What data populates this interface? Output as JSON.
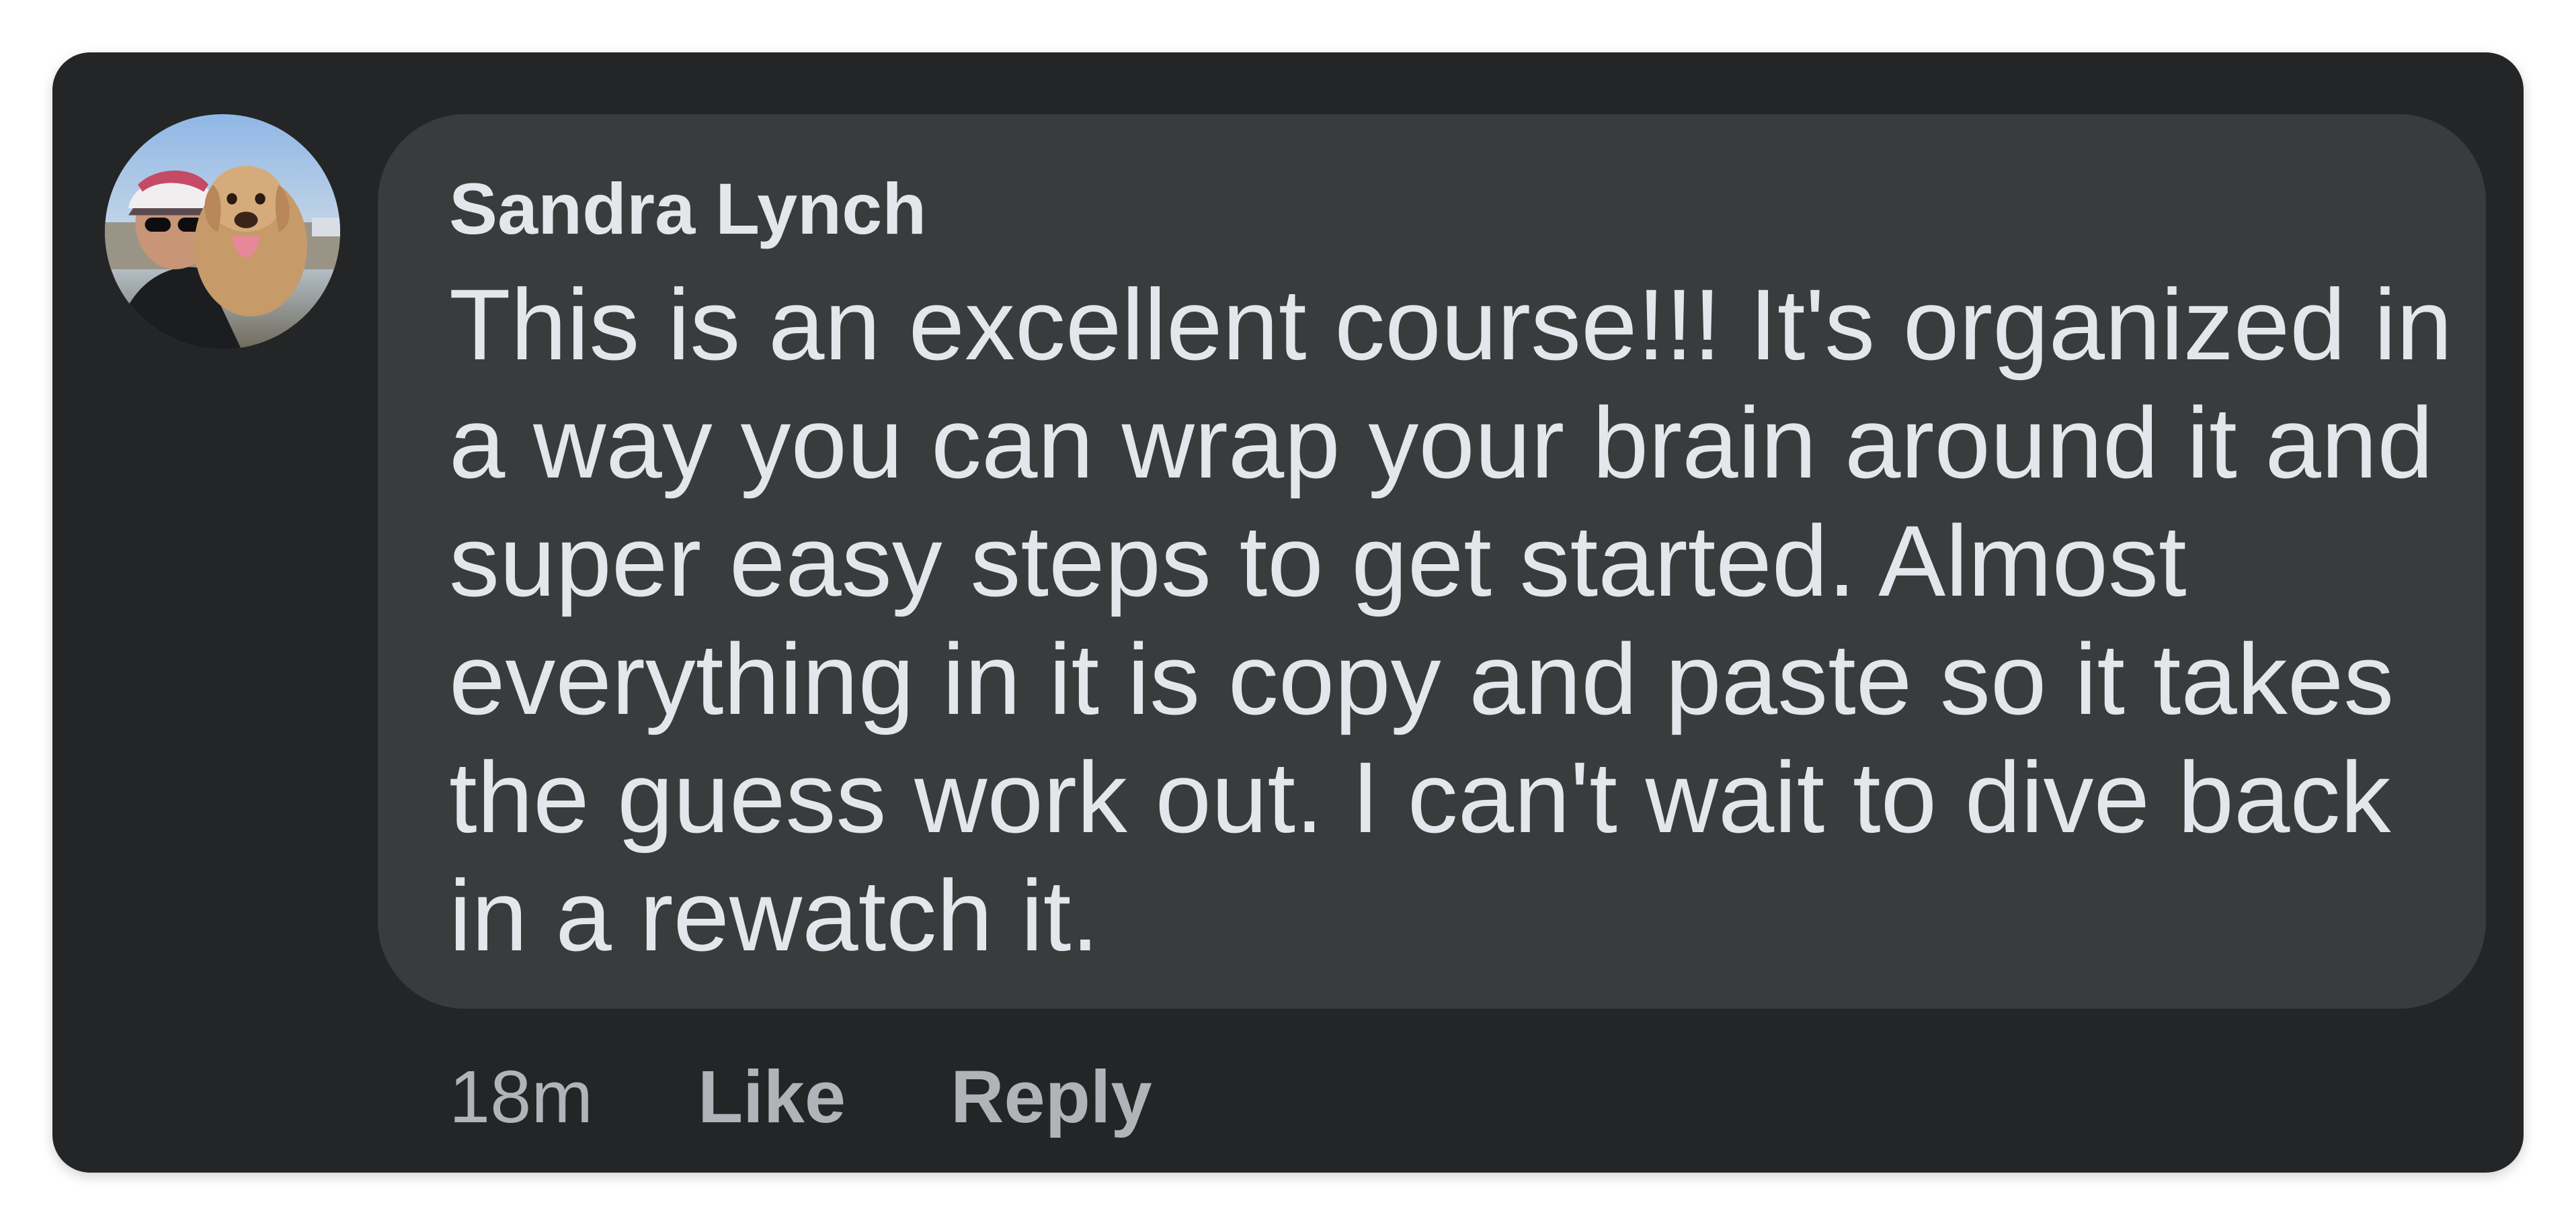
{
  "comment": {
    "author": "Sandra Lynch",
    "text": "This is an excellent course!!!  It's organized in a way you can wrap your brain around it and super easy steps to get started. Almost everything in it is copy and paste so it takes the guess work out. I can't wait to dive back in a rewatch it.",
    "timestamp": "18m",
    "like_label": "Like",
    "reply_label": "Reply"
  },
  "colors": {
    "card_background": "#242526",
    "bubble_background": "#3a3b3c",
    "primary_text": "#e4e6eb",
    "secondary_text": "#b0b3b8"
  }
}
